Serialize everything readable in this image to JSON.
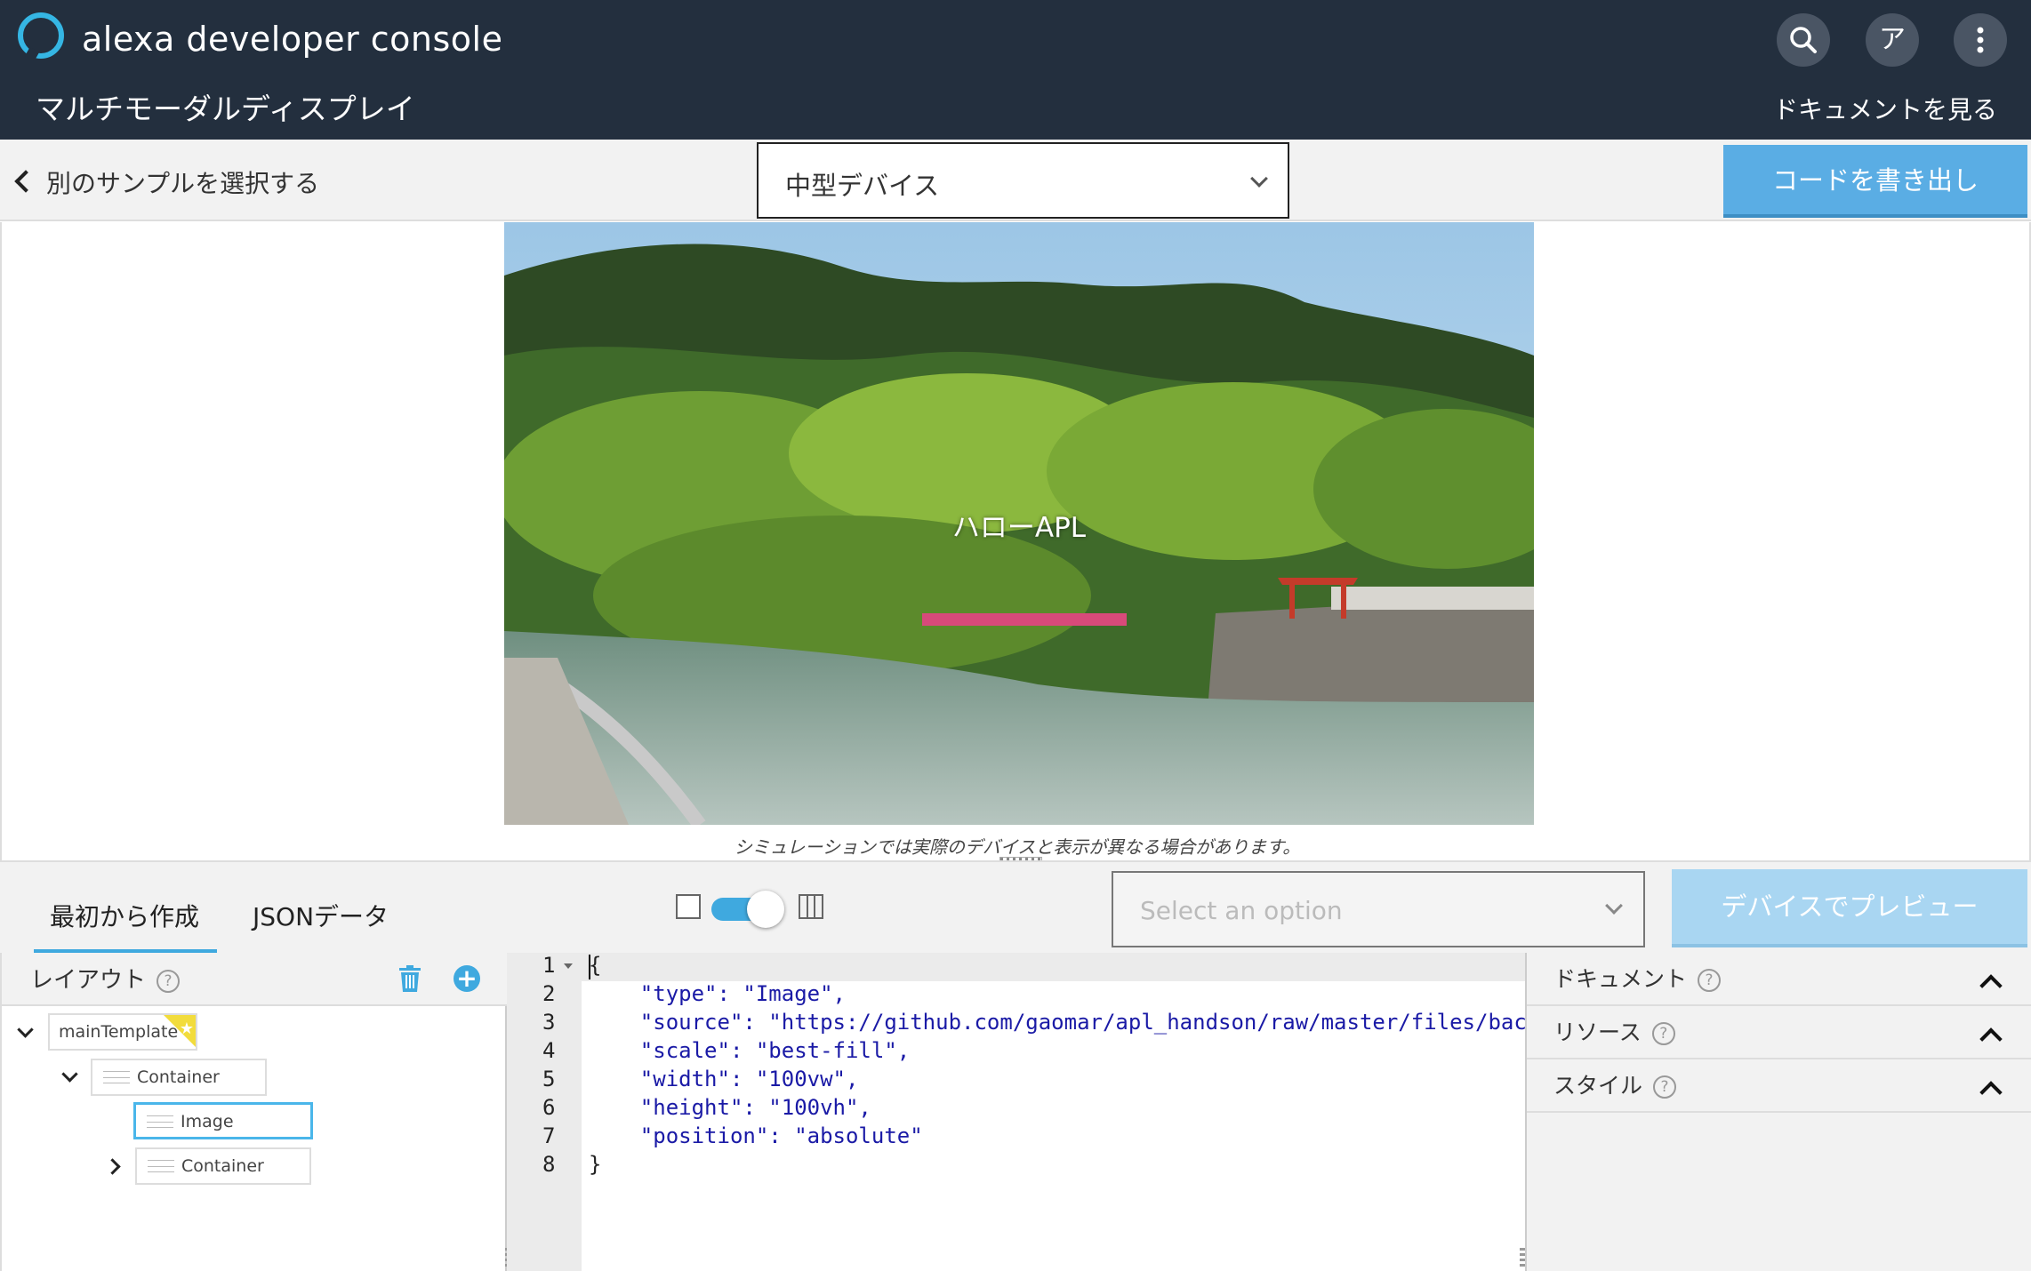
{
  "header": {
    "app_title": "alexa developer console",
    "section_title": "マルチモーダルディスプレイ",
    "search_icon": "search-icon",
    "user_initial": "ア",
    "menu_icon": "more-vertical-icon",
    "docs_link": "ドキュメントを見る"
  },
  "toolbar": {
    "back_label": "別のサンプルを選択する",
    "device_select_value": "中型デバイス",
    "export_label": "コードを書き出し"
  },
  "preview": {
    "overlay_text": "ハローAPL",
    "simulation_note": "シミュレーションでは実際のデバイスと表示が異なる場合があります。"
  },
  "controls": {
    "tabs": [
      {
        "label": "最初から作成",
        "active": true
      },
      {
        "label": "JSONデータ",
        "active": false
      }
    ],
    "view_toggle_on": true,
    "option_placeholder": "Select an option",
    "preview_button": "デバイスでプレビュー"
  },
  "layout_panel": {
    "title": "レイアウト",
    "help": "?",
    "add": "+",
    "tree": {
      "root": "mainTemplate",
      "container": "Container",
      "image": "Image",
      "child_container": "Container"
    }
  },
  "editor": {
    "line_numbers": [
      "1",
      "2",
      "3",
      "4",
      "5",
      "6",
      "7",
      "8"
    ],
    "lines": [
      "{",
      "    \"type\": \"Image\",",
      "    \"source\": \"https://github.com/gaomar/apl_handson/raw/master/files/bac",
      "    \"scale\": \"best-fill\",",
      "    \"width\": \"100vw\",",
      "    \"height\": \"100vh\",",
      "    \"position\": \"absolute\"",
      "}"
    ]
  },
  "right_panel": {
    "sections": [
      {
        "label": "ドキュメント",
        "help": "?"
      },
      {
        "label": "リソース",
        "help": "?"
      },
      {
        "label": "スタイル",
        "help": "?"
      }
    ]
  },
  "colors": {
    "header_bg": "#232f3e",
    "accent": "#3fa9df",
    "export_button": "#5aade4",
    "preview_button_disabled": "#a9d6f2"
  }
}
